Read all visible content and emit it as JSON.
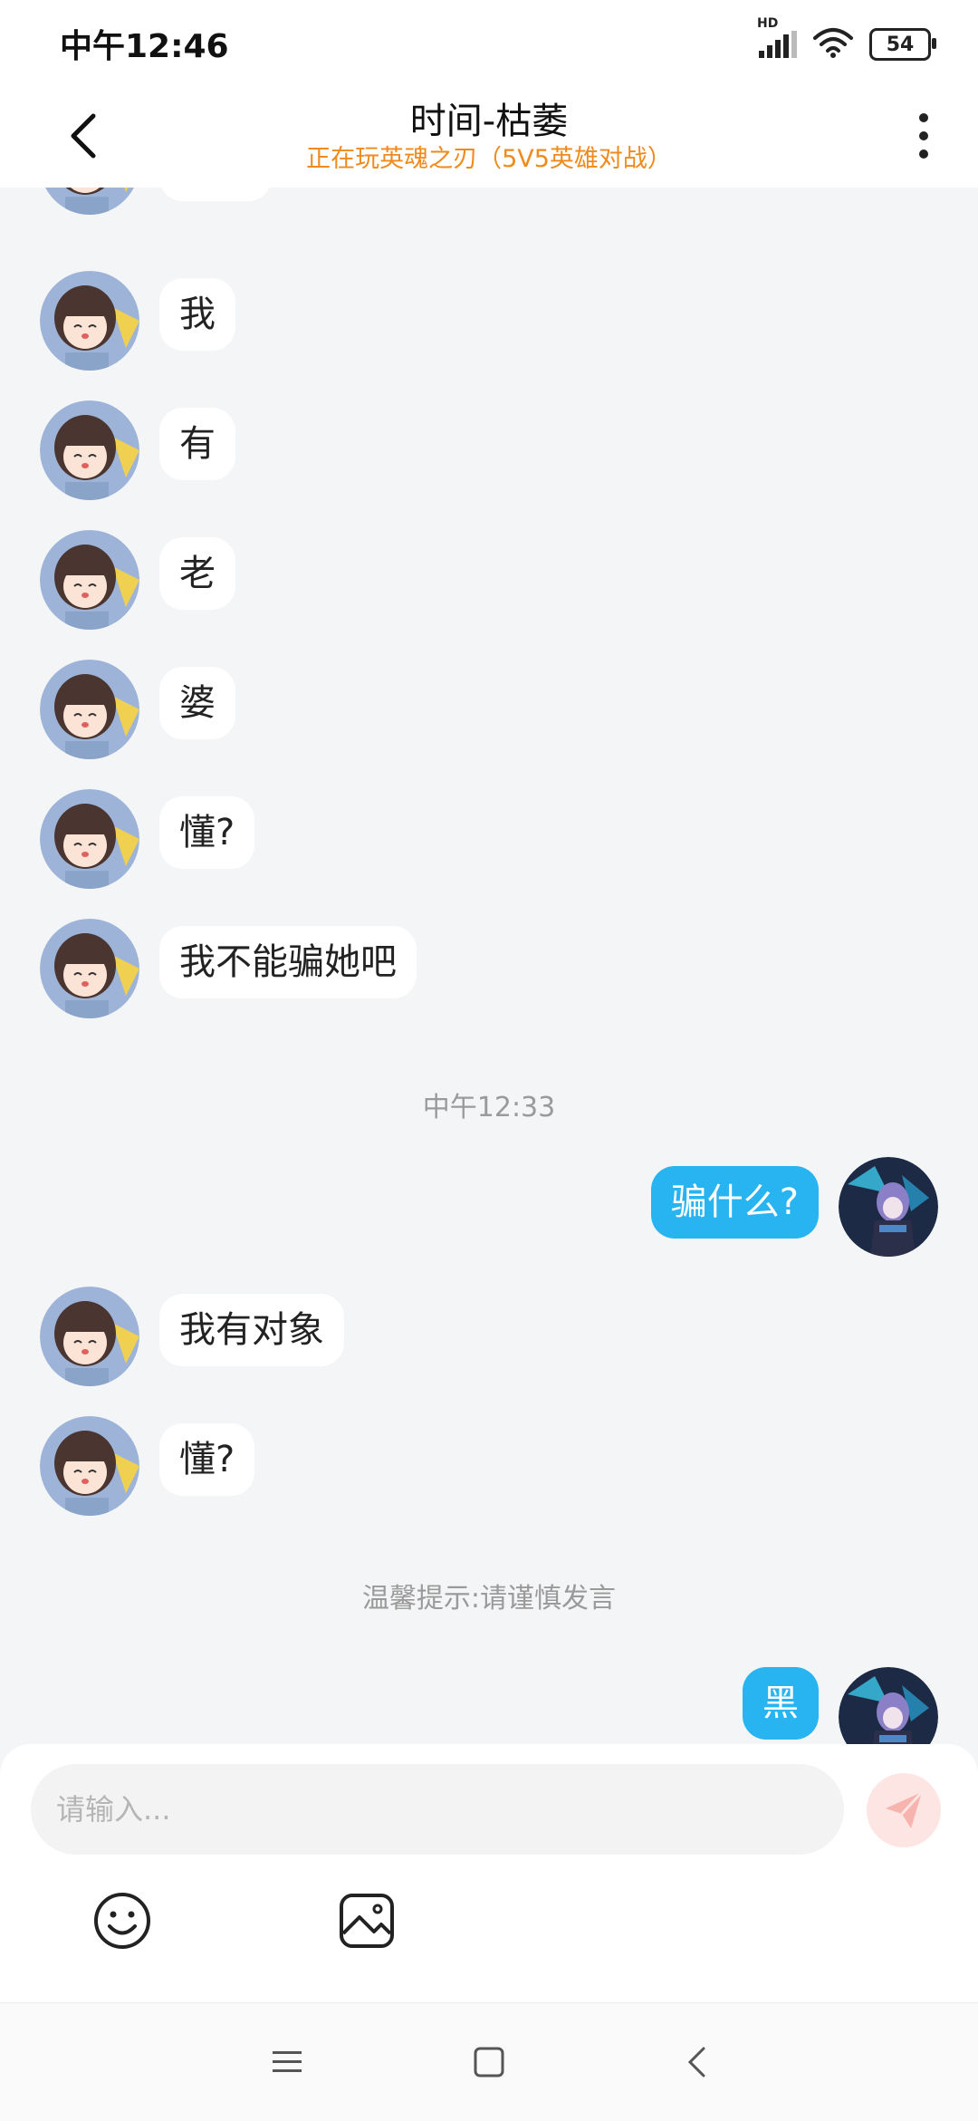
{
  "status_bar": {
    "time": "中午12:46",
    "network": "HD",
    "battery": "54"
  },
  "header": {
    "title": "时间-枯萎",
    "subtitle": "正在玩英魂之刃（5V5英雄对战）"
  },
  "messages": [
    {
      "side": "left",
      "text": "。。。"
    },
    {
      "side": "left",
      "text": "我"
    },
    {
      "side": "left",
      "text": "有"
    },
    {
      "side": "left",
      "text": "老"
    },
    {
      "side": "left",
      "text": "婆"
    },
    {
      "side": "left",
      "text": "懂?"
    },
    {
      "side": "left",
      "text": "我不能骗她吧"
    },
    {
      "side": "right",
      "text": "骗什么?"
    },
    {
      "side": "left",
      "text": "我有对象"
    },
    {
      "side": "left",
      "text": "懂?"
    },
    {
      "side": "right",
      "text": "黑"
    }
  ],
  "timestamps": {
    "t1": "中午12:33",
    "notice": "温馨提示:请谨慎发言"
  },
  "input": {
    "placeholder": "请输入..."
  },
  "icons": {
    "back": "chevron-left-icon",
    "more": "more-vertical-icon",
    "send": "send-icon",
    "emoji": "emoji-icon",
    "image": "image-icon"
  },
  "colors": {
    "accent_bubble": "#28b4f0",
    "subtitle": "#f08a1c",
    "send_bg": "#fde5e3",
    "send_icon": "#f7b3ad"
  }
}
